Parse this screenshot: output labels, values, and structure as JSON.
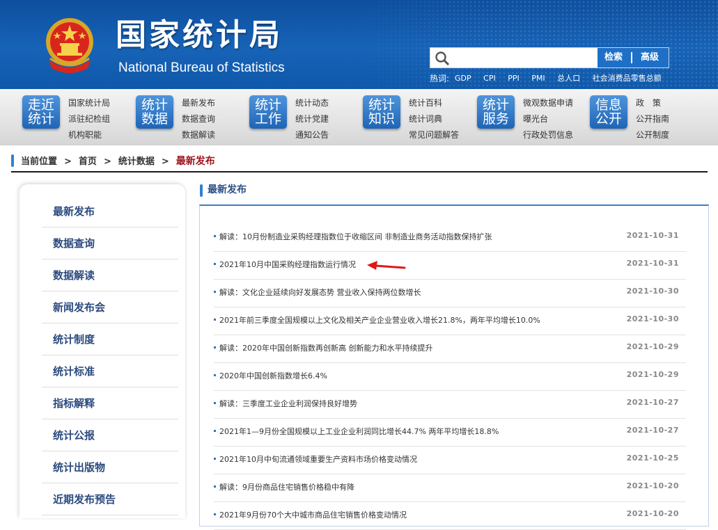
{
  "header": {
    "title_cn": "国家统计局",
    "title_en": "National Bureau of Statistics",
    "search": {
      "placeholder": "",
      "button_search": "检索",
      "button_advanced": "高级"
    },
    "hot_label": "热词:",
    "hot_words": [
      "GDP",
      "CPI",
      "PPI",
      "PMI",
      "总人口",
      "社会消费品零售总额"
    ]
  },
  "nav": [
    {
      "tile": [
        "走近",
        "统计"
      ],
      "links": [
        "国家统计局",
        "派驻纪检组",
        "机构职能"
      ]
    },
    {
      "tile": [
        "统计",
        "数据"
      ],
      "links": [
        "最新发布",
        "数据查询",
        "数据解读"
      ]
    },
    {
      "tile": [
        "统计",
        "工作"
      ],
      "links": [
        "统计动态",
        "统计党建",
        "通知公告"
      ]
    },
    {
      "tile": [
        "统计",
        "知识"
      ],
      "links": [
        "统计百科",
        "统计词典",
        "常见问题解答"
      ]
    },
    {
      "tile": [
        "统计",
        "服务"
      ],
      "links": [
        "微观数据申请",
        "曝光台",
        "行政处罚信息"
      ]
    },
    {
      "tile": [
        "信息",
        "公开"
      ],
      "links": [
        "政　策",
        "公开指南",
        "公开制度"
      ]
    }
  ],
  "breadcrumb": {
    "label": "当前位置",
    "items": [
      "首页",
      "统计数据"
    ],
    "current": "最新发布",
    "separator": ">"
  },
  "sidebar": {
    "items": [
      "最新发布",
      "数据查询",
      "数据解读",
      "新闻发布会",
      "统计制度",
      "统计标准",
      "指标解释",
      "统计公报",
      "统计出版物",
      "近期发布预告"
    ]
  },
  "main": {
    "section_title": "最新发布",
    "news": [
      {
        "title": "解读：10月份制造业采购经理指数位于收缩区间 非制造业商务活动指数保持扩张",
        "date": "2021-10-31"
      },
      {
        "title": "2021年10月中国采购经理指数运行情况",
        "date": "2021-10-31"
      },
      {
        "title": "解读：文化企业延续向好发展态势 营业收入保持两位数增长",
        "date": "2021-10-30"
      },
      {
        "title": "2021年前三季度全国规模以上文化及相关产业企业营业收入增长21.8%，两年平均增长10.0%",
        "date": "2021-10-30"
      },
      {
        "title": "解读：2020年中国创新指数再创新高 创新能力和水平持续提升",
        "date": "2021-10-29"
      },
      {
        "title": "2020年中国创新指数增长6.4%",
        "date": "2021-10-29"
      },
      {
        "title": "解读：三季度工业企业利润保持良好增势",
        "date": "2021-10-27"
      },
      {
        "title": "2021年1—9月份全国规模以上工业企业利润同比增长44.7% 两年平均增长18.8%",
        "date": "2021-10-27"
      },
      {
        "title": "2021年10月中旬流通领域重要生产资料市场价格变动情况",
        "date": "2021-10-25"
      },
      {
        "title": "解读：9月份商品住宅销售价格稳中有降",
        "date": "2021-10-20"
      },
      {
        "title": "2021年9月份70个大中城市商品住宅销售价格变动情况",
        "date": "2021-10-20"
      }
    ]
  },
  "colors": {
    "header_blue": "#1763b7",
    "accent_red": "#a0141e",
    "link_blue": "#2c4a7e",
    "annotation_arrow": "#e01818"
  }
}
